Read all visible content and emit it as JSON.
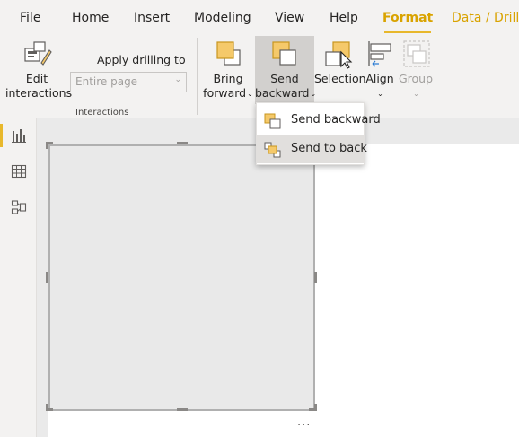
{
  "menubar": {
    "tabs": [
      {
        "label": "File"
      },
      {
        "label": "Home"
      },
      {
        "label": "Insert"
      },
      {
        "label": "Modeling"
      },
      {
        "label": "View"
      },
      {
        "label": "Help"
      },
      {
        "label": "Format"
      },
      {
        "label": "Data / Drill"
      }
    ],
    "active_tab": "Format"
  },
  "ribbon": {
    "edit_interactions": {
      "line1": "Edit",
      "line2": "interactions",
      "icon": "edit-interactions-icon"
    },
    "apply_drilling": {
      "label": "Apply drilling to",
      "value": "Entire page"
    },
    "group_label": "Interactions",
    "bring_forward": {
      "line1": "Bring",
      "line2": "forward",
      "icon": "bring-forward-icon"
    },
    "send_backward": {
      "line1": "Send",
      "line2": "backward",
      "icon": "send-backward-icon",
      "pressed": true
    },
    "selection": {
      "line1": "Selection",
      "icon": "selection-pane-icon"
    },
    "align": {
      "line1": "Align",
      "icon": "align-icon"
    },
    "group": {
      "line1": "Group",
      "icon": "group-icon",
      "disabled": true
    }
  },
  "dropdown": {
    "items": [
      {
        "label": "Send backward",
        "icon": "send-backward-icon"
      },
      {
        "label": "Send to back",
        "icon": "send-to-back-icon",
        "hovered": true
      }
    ]
  },
  "leftnav": {
    "items": [
      {
        "name": "report-view",
        "icon": "bar-chart-icon",
        "active": true
      },
      {
        "name": "data-view",
        "icon": "table-icon"
      },
      {
        "name": "model-view",
        "icon": "model-icon"
      }
    ]
  },
  "canvas": {
    "more_options": "..."
  },
  "colors": {
    "accent": "#e8b82c",
    "accent_text": "#d9a300",
    "ribbon_bg": "#f3f2f1",
    "icon_fill": "#f5c96a",
    "icon_stroke": "#605e5c"
  }
}
